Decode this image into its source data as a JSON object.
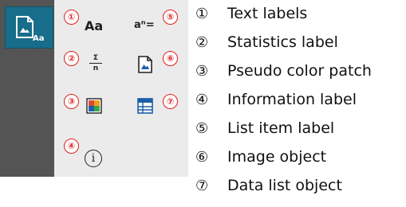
{
  "sidebar": {
    "active_tool": "text-labels-tool"
  },
  "palette": {
    "text_label_glyph": "Aa",
    "list_item_glyph": "aⁿ=",
    "statistics_numerator": "Σ",
    "statistics_denominator": "n",
    "info_glyph": "i",
    "badges": [
      "①",
      "②",
      "③",
      "④",
      "⑤",
      "⑥",
      "⑦"
    ],
    "badge_color": "#e02020",
    "accent_color": "#176d8a"
  },
  "legend": [
    {
      "num": "①",
      "label": "Text labels"
    },
    {
      "num": "②",
      "label": "Statistics label"
    },
    {
      "num": "③",
      "label": "Pseudo color patch"
    },
    {
      "num": "④",
      "label": "Information label"
    },
    {
      "num": "⑤",
      "label": "List item label"
    },
    {
      "num": "⑥",
      "label": "Image object"
    },
    {
      "num": "⑦",
      "label": "Data list object"
    }
  ]
}
